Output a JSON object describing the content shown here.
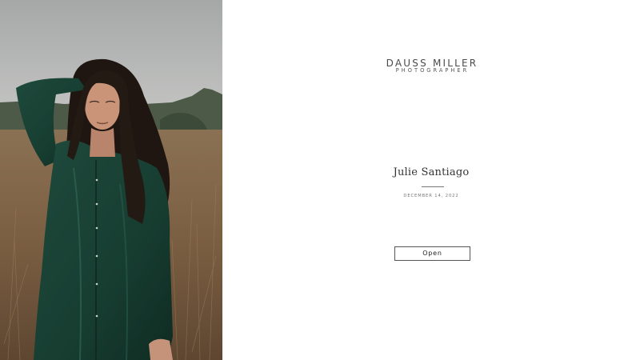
{
  "cover": {
    "photo": "cover-photo"
  },
  "brand": {
    "name": "DAUSS MILLER",
    "tagline": "PHOTOGRAPHER"
  },
  "gallery": {
    "title": "Julie Santiago",
    "date": "DECEMBER 14, 2022",
    "open_label": "Open"
  }
}
